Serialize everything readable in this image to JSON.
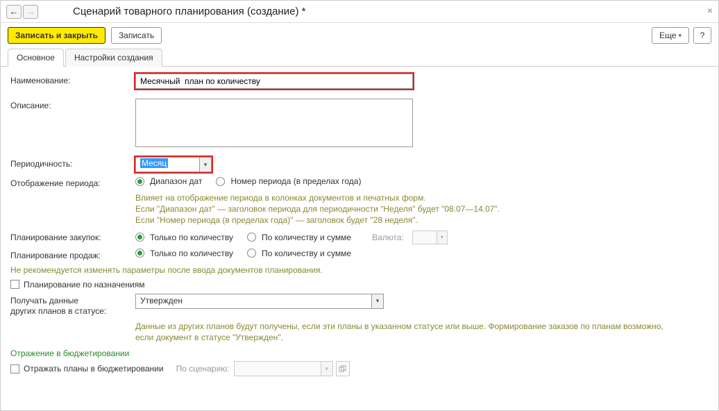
{
  "titlebar": {
    "title": "Сценарий товарного планирования (создание) *",
    "back": "←",
    "forward": "→",
    "close": "×"
  },
  "toolbar": {
    "save_close": "Записать и закрыть",
    "save": "Записать",
    "more": "Еще",
    "help": "?"
  },
  "tabs": {
    "main": "Основное",
    "settings": "Настройки создания"
  },
  "labels": {
    "name": "Наименование:",
    "description": "Описание:",
    "periodicity": "Периодичность:",
    "period_display": "Отображение периода:",
    "plan_purchases": "Планирование закупок:",
    "plan_sales": "Планирование продаж:",
    "currency": "Валюта:",
    "receive_data_l1": "Получать данные",
    "receive_data_l2": "других планов в статусе:",
    "by_scenario": "По сценарию:"
  },
  "fields": {
    "name_value": "Месячный  план по количеству",
    "description_value": "",
    "periodicity_value": "Месяц",
    "status_value": "Утвержден",
    "scenario_value": ""
  },
  "radios": {
    "date_range": "Диапазон дат",
    "period_number": "Номер периода (в пределах года)",
    "only_qty": "Только по количеству",
    "qty_and_sum": "По количеству и сумме"
  },
  "hints": {
    "period_l1": "Влияет на отображение периода в колонках документов и печатных форм.",
    "period_l2": "Если \"Диапазон дат\" — заголовок периода для периодичности \"Неделя\" будет \"08.07—14.07\".",
    "period_l3": "Если \"Номер периода (в пределах года)\" — заголовок будет \"28 неделя\".",
    "params_warn": "Не рекомендуется изменять параметры после ввода документов планирования.",
    "status_l1": "Данные из других планов будут получены, если эти планы в указанном статусе или выше. Формирование заказов по планам возможно,",
    "status_l2": "если документ в статусе \"Утвержден\"."
  },
  "checkboxes": {
    "plan_by_purpose": "Планирование по назначениям",
    "reflect_budget": "Отражать планы в бюджетировании"
  },
  "sections": {
    "budget": "Отражение в бюджетировании"
  }
}
